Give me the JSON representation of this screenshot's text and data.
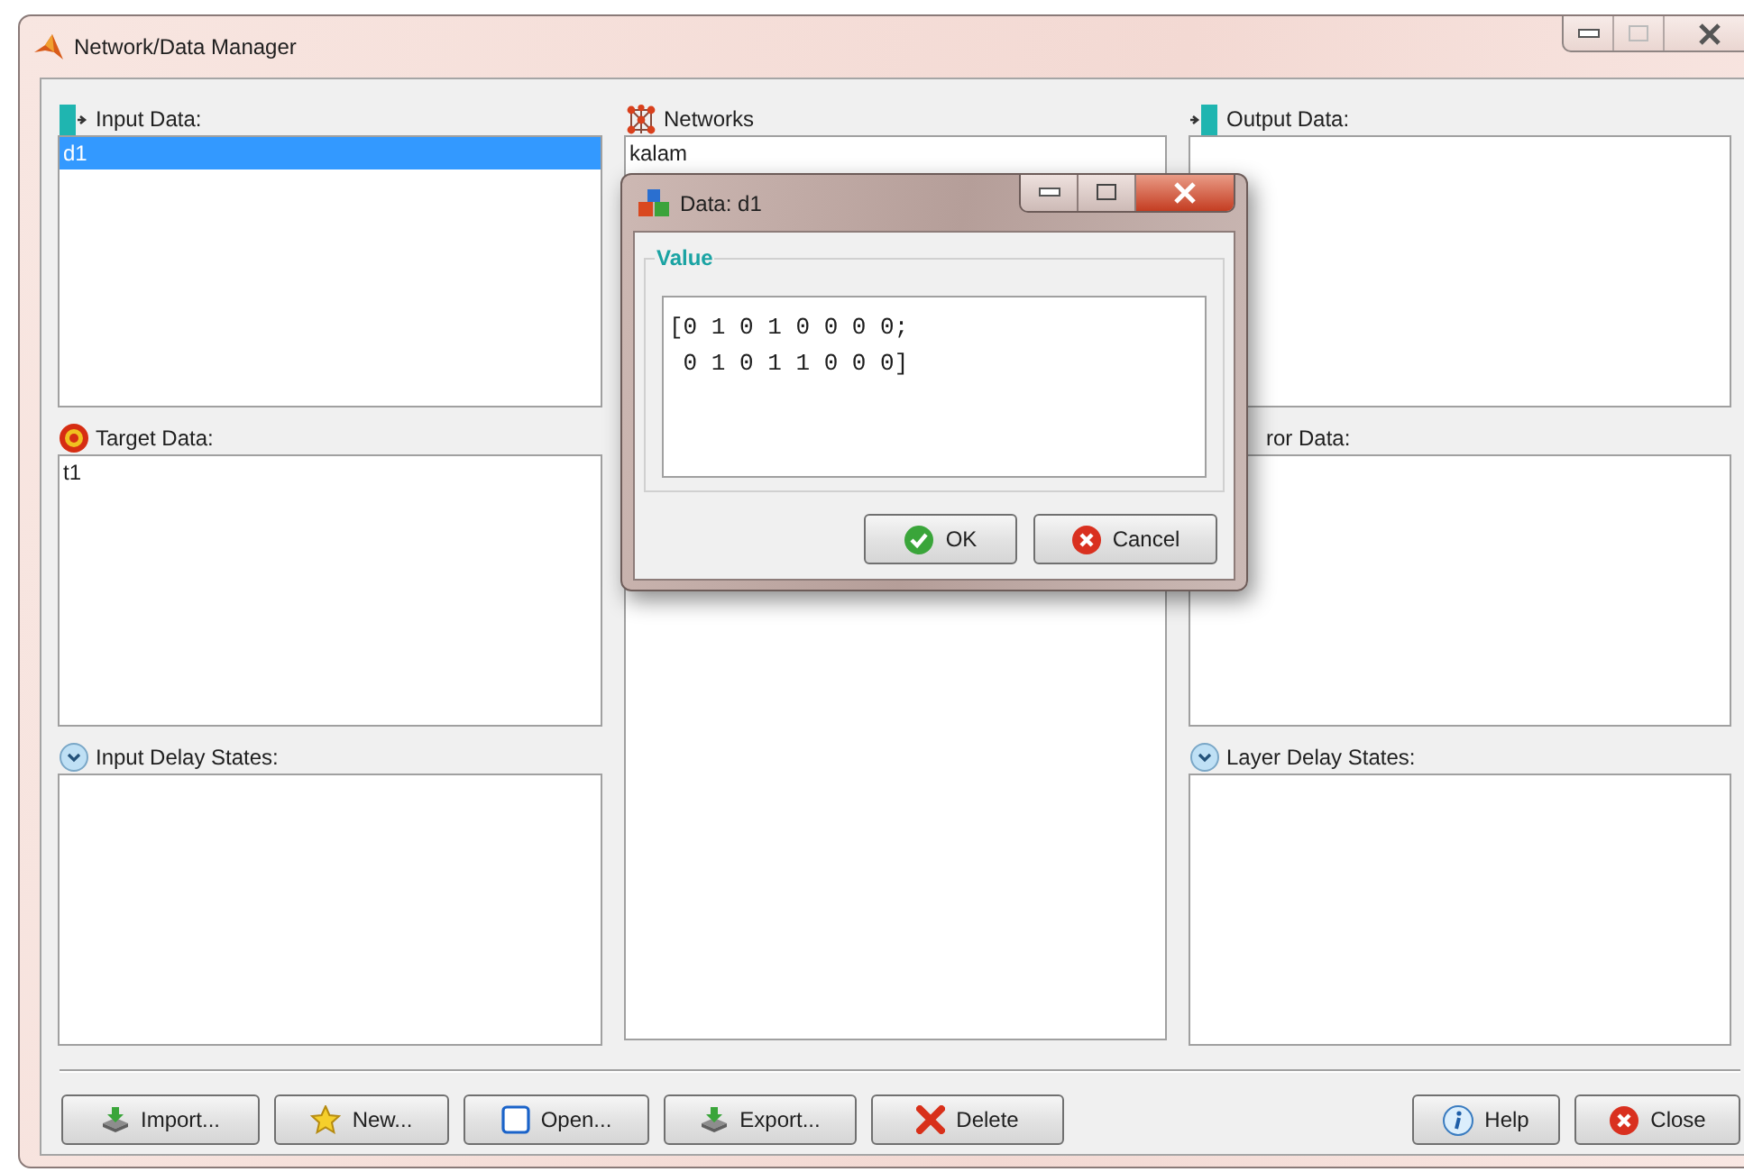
{
  "window": {
    "title": "Network/Data Manager"
  },
  "left_panels": [
    {
      "title": "Input Data:",
      "items": [
        {
          "label": "d1",
          "selected": true
        }
      ]
    },
    {
      "title": "Target Data:",
      "items": [
        {
          "label": "t1",
          "selected": false
        }
      ]
    },
    {
      "title": "Input Delay States:"
    }
  ],
  "networks": {
    "title": "Networks",
    "items": [
      {
        "label": "kalam",
        "selected": false
      }
    ]
  },
  "right_panels": [
    {
      "title": "Output Data:"
    },
    {
      "title": "ror Data:"
    },
    {
      "title": "Layer Delay States:"
    }
  ],
  "buttons_left": [
    {
      "label": "Import..."
    },
    {
      "label": "New..."
    },
    {
      "label": "Open..."
    },
    {
      "label": "Export..."
    },
    {
      "label": "Delete"
    }
  ],
  "buttons_right": [
    {
      "label": "Help"
    },
    {
      "label": "Close"
    }
  ],
  "dialog": {
    "title": "Data: d1",
    "group": "Value",
    "value": "[0 1 0 1 0 0 0 0;\n 0 1 0 1 1 0 0 0]",
    "buttons": [
      {
        "label": "OK"
      },
      {
        "label": "Cancel"
      }
    ]
  }
}
